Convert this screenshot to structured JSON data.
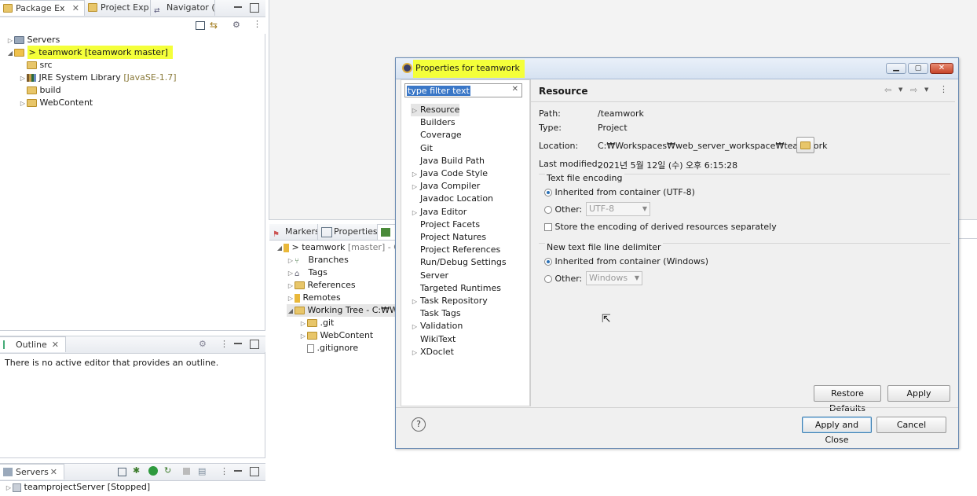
{
  "left_panel": {
    "tabs": [
      "Package Ex",
      "Project Exp",
      "Navigator ("
    ],
    "tree": [
      {
        "label": "Servers",
        "suffix": ""
      },
      {
        "label": "> teamwork [teamwork master]",
        "suffix": ""
      },
      {
        "label": "src",
        "suffix": ""
      },
      {
        "label": "JRE System Library",
        "suffix": "[JavaSE-1.7]"
      },
      {
        "label": "build",
        "suffix": ""
      },
      {
        "label": "WebContent",
        "suffix": ""
      }
    ]
  },
  "outline": {
    "tab": "Outline",
    "message": "There is no active editor that provides an outline."
  },
  "servers": {
    "tab": "Servers",
    "item": "teamprojectServer",
    "status": "[Stopped]"
  },
  "middle_panel": {
    "tabs": [
      "Markers",
      "Properties"
    ],
    "tree": [
      {
        "label": "> teamwork",
        "suffix": "[master] - C"
      },
      {
        "label": "Branches",
        "suffix": ""
      },
      {
        "label": "Tags",
        "suffix": ""
      },
      {
        "label": "References",
        "suffix": ""
      },
      {
        "label": "Remotes",
        "suffix": ""
      },
      {
        "label": "Working Tree - C:₩Wo",
        "suffix": ""
      },
      {
        "label": ".git",
        "suffix": ""
      },
      {
        "label": "WebContent",
        "suffix": ""
      },
      {
        "label": ".gitignore",
        "suffix": ""
      }
    ]
  },
  "dialog": {
    "title": "Properties for teamwork",
    "filter_value": "type filter text",
    "nav_items": [
      "Resource",
      "Builders",
      "Coverage",
      "Git",
      "Java Build Path",
      "Java Code Style",
      "Java Compiler",
      "Javadoc Location",
      "Java Editor",
      "Project Facets",
      "Project Natures",
      "Project References",
      "Run/Debug Settings",
      "Server",
      "Targeted Runtimes",
      "Task Repository",
      "Task Tags",
      "Validation",
      "WikiText",
      "XDoclet"
    ],
    "page_title": "Resource",
    "fields": {
      "path_label": "Path:",
      "path_value": "/teamwork",
      "type_label": "Type:",
      "type_value": "Project",
      "location_label": "Location:",
      "location_value": "C:₩Workspaces₩web_server_workspace₩teamwork",
      "modified_label": "Last modified:",
      "modified_value": "2021년 5월 12일 (수) 오후 6:15:28"
    },
    "encoding": {
      "group": "Text file encoding",
      "inherited": "Inherited from container (UTF-8)",
      "other": "Other:",
      "other_value": "UTF-8",
      "store": "Store the encoding of derived resources separately"
    },
    "delimiter": {
      "group": "New text file line delimiter",
      "inherited": "Inherited from container (Windows)",
      "other": "Other:",
      "other_value": "Windows"
    },
    "buttons": {
      "restore": "Restore Defaults",
      "apply": "Apply",
      "apply_close": "Apply and Close",
      "cancel": "Cancel",
      "help": "?"
    }
  }
}
